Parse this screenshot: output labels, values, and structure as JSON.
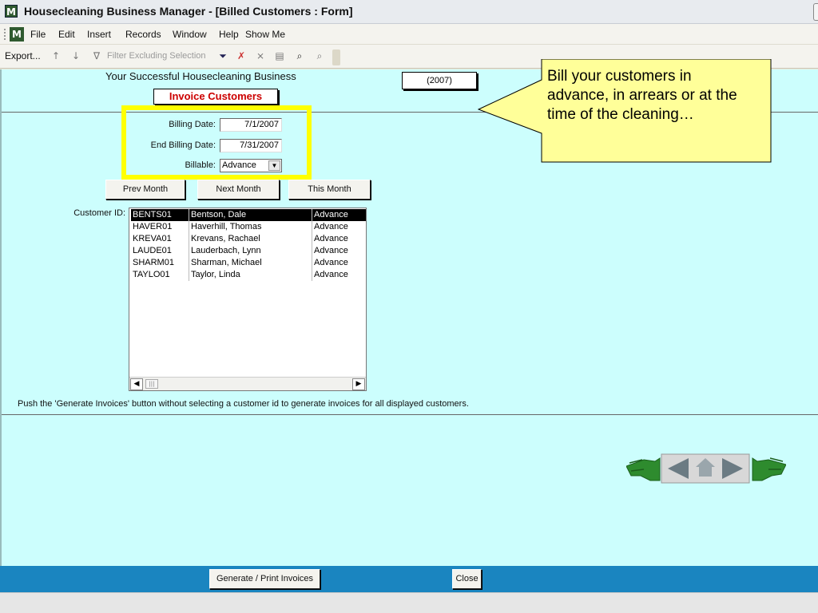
{
  "window": {
    "title": "Housecleaning Business Manager - [Billed Customers : Form]"
  },
  "menu": [
    {
      "label": "File"
    },
    {
      "label": "Edit"
    },
    {
      "label": "Insert"
    },
    {
      "label": "Records"
    },
    {
      "label": "Window"
    },
    {
      "label": "Help"
    },
    {
      "label": "Show Me"
    }
  ],
  "toolbar": {
    "export_label": "Export...",
    "filter_label": "Filter Excluding Selection"
  },
  "form": {
    "business_name": "Your Successful Housecleaning Business",
    "year": "(2007)",
    "title": "Invoice Customers",
    "billing_date_label": "Billing Date:",
    "billing_date": "7/1/2007",
    "end_billing_date_label": "End Billing Date:",
    "end_billing_date": "7/31/2007",
    "billable_label": "Billable:",
    "billable_value": "Advance",
    "prev_month": "Prev Month",
    "next_month": "Next Month",
    "this_month": "This Month",
    "customer_id_label": "Customer ID:",
    "hint": "Push the 'Generate Invoices' button without selecting a customer id to generate invoices for all displayed customers."
  },
  "customers": [
    {
      "id": "BENTS01",
      "name": "Bentson, Dale",
      "billable": "Advance",
      "selected": true
    },
    {
      "id": "HAVER01",
      "name": "Haverhill, Thomas",
      "billable": "Advance",
      "selected": false
    },
    {
      "id": "KREVA01",
      "name": "Krevans, Rachael",
      "billable": "Advance",
      "selected": false
    },
    {
      "id": "LAUDE01",
      "name": "Lauderbach, Lynn",
      "billable": "Advance",
      "selected": false
    },
    {
      "id": "SHARM01",
      "name": "Sharman, Michael",
      "billable": "Advance",
      "selected": false
    },
    {
      "id": "TAYLO01",
      "name": "Taylor, Linda",
      "billable": "Advance",
      "selected": false
    }
  ],
  "callout": {
    "text": "Bill your customers in advance, in arrears or at the time of the cleaning…",
    "fill": "#ffff99"
  },
  "footer": {
    "generate_label": "Generate / Print Invoices",
    "close_label": "Close"
  },
  "colors": {
    "form_background": "#ccfefd",
    "footer_background": "#1a85c0",
    "highlight": "#ffff00"
  },
  "icons": [
    "app-icon",
    "sort-ascending-icon",
    "sort-descending-icon",
    "filter-by-selection-icon",
    "filter-icon",
    "remove-filter-icon",
    "find-icon",
    "binoculars-icon",
    "toolbar-options-icon",
    "hand-left-icon",
    "back-arrow-icon",
    "home-icon",
    "forward-arrow-icon",
    "hand-right-icon"
  ]
}
